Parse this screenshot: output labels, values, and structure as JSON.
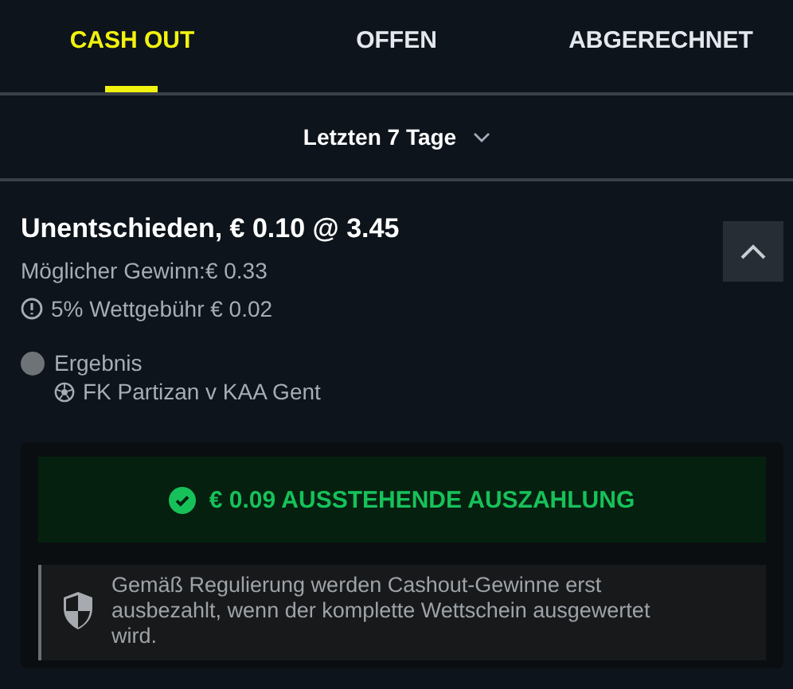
{
  "tabs": [
    {
      "label": "CASH OUT",
      "selected": true
    },
    {
      "label": "OFFEN",
      "selected": false
    },
    {
      "label": "ABGERECHNET",
      "selected": false
    }
  ],
  "filter": {
    "label": "Letzten 7 Tage"
  },
  "bet": {
    "title": "Unentschieden, € 0.10 @ 3.45",
    "potential_win": "Möglicher Gewinn:€ 0.33",
    "fee": "5% Wettgebühr € 0.02",
    "expanded": true,
    "selection": {
      "market": "Ergebnis",
      "event": "FK Partizan v KAA Gent"
    },
    "payout": "€ 0.09 AUSSTEHENDE AUSZAHLUNG",
    "notice": "Gemäß Regulierung werden Cashout-Gewinne erst ausbezahlt, wenn der komplette Wettschein ausgewertet wird."
  }
}
